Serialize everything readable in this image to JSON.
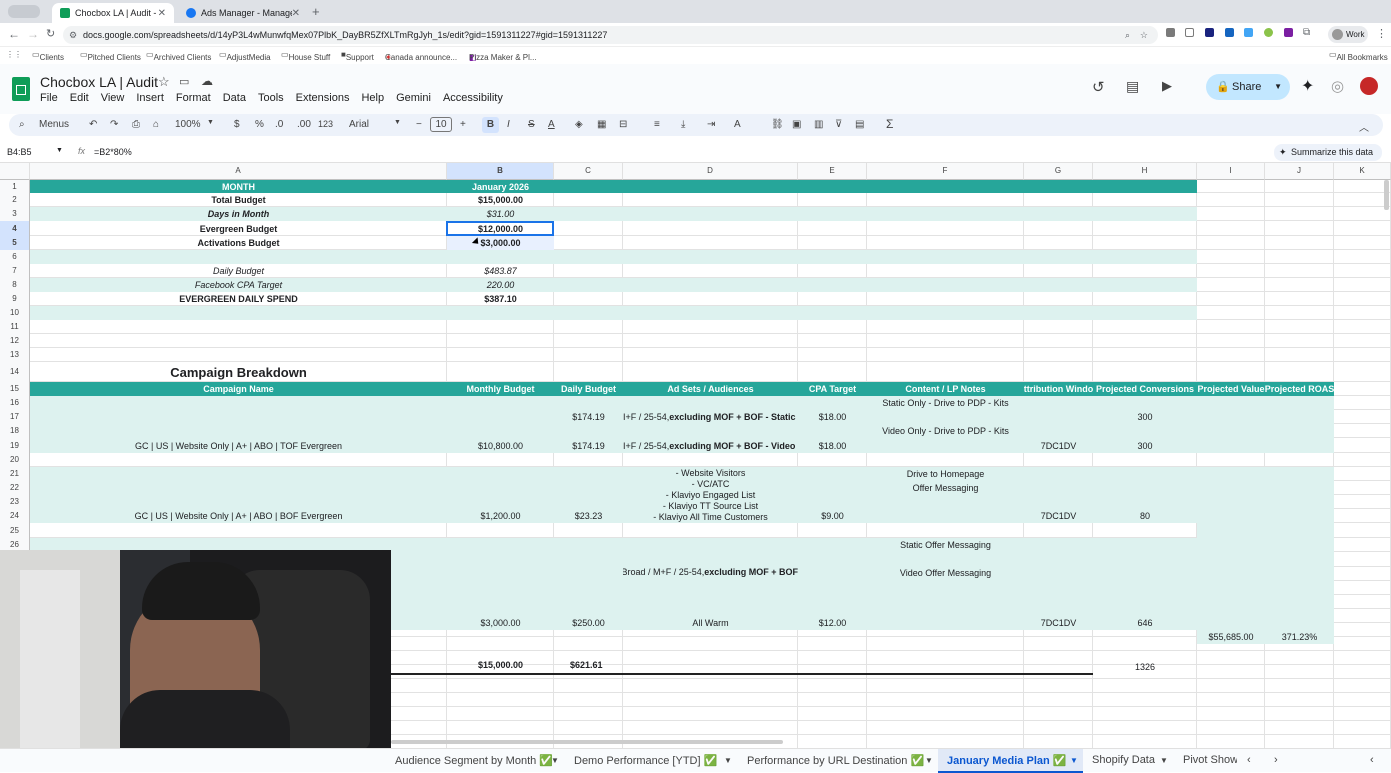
{
  "browser": {
    "tabs": [
      {
        "title": "Chocbox LA | Audit - Google",
        "active": true,
        "favicon_color": "#0f9d58"
      },
      {
        "title": "Ads Manager - Manage ads -",
        "active": false,
        "favicon_color": "#1877f2"
      }
    ],
    "url": "docs.google.com/spreadsheets/d/14yP3L4wMunwfqMex07PlbK_DayBR5ZfXLTmRgJyh_1s/edit?gid=1591311227#gid=1591311227",
    "profile": "Work",
    "bookmarks": [
      "Clients",
      "Pitched Clients",
      "Archived Clients",
      "AdjustMedia",
      "House Stuff",
      "Support",
      "Canada announce...",
      "Pizza Maker & Pl..."
    ],
    "all_bookmarks": "All Bookmarks"
  },
  "doc": {
    "title": "Chocbox LA | Audit",
    "menus": [
      "File",
      "Edit",
      "View",
      "Insert",
      "Format",
      "Data",
      "Tools",
      "Extensions",
      "Help",
      "Gemini",
      "Accessibility"
    ],
    "share_label": "Share"
  },
  "toolbar": {
    "menus_label": "Menus",
    "zoom": "100%",
    "currency": "$",
    "percent": "%",
    "dec_less": ".0",
    "dec_more": ".00",
    "number_format": "123",
    "font": "Arial",
    "font_size": "10",
    "bold": "B",
    "italic": "I",
    "strike": "S",
    "text_color": "A",
    "sum": "Σ",
    "minus": "−",
    "plus": "+"
  },
  "formula_bar": {
    "name_box": "B4:B5",
    "fx": "fx",
    "formula": "=B2*80%",
    "summarize": "Summarize this data"
  },
  "columns": [
    "A",
    "B",
    "C",
    "D",
    "E",
    "F",
    "G",
    "H",
    "I",
    "J",
    "K"
  ],
  "rows": [
    "1",
    "2",
    "3",
    "4",
    "5",
    "6",
    "7",
    "8",
    "9",
    "10",
    "11",
    "12",
    "13",
    "14",
    "15",
    "16",
    "17",
    "18",
    "19",
    "20",
    "21",
    "22",
    "23",
    "24",
    "25",
    "26"
  ],
  "summary": {
    "month_label": "MONTH",
    "month_value": "January 2026",
    "total_budget_label": "Total Budget",
    "total_budget": "$15,000.00",
    "days_label": "Days in Month",
    "days": "$31.00",
    "evergreen_label": "Evergreen Budget",
    "evergreen": "$12,000.00",
    "activations_label": "Activations Budget",
    "activations": "$3,000.00",
    "daily_label": "Daily Budget",
    "daily": "$483.87",
    "cpa_label": "Facebook CPA Target",
    "cpa": "220.00",
    "evergreen_daily_label": "EVERGREEN DAILY SPEND",
    "evergreen_daily": "$387.10"
  },
  "breakdown": {
    "title": "Campaign Breakdown",
    "headers": [
      "Campaign Name",
      "Monthly Budget",
      "Daily Budget",
      "Ad Sets / Audiences",
      "CPA Target",
      "Content / LP Notes",
      "ttribution Windo",
      "Projected Conversions",
      "Projected Value",
      "Projected ROAS"
    ],
    "tof": {
      "name": "GC | US | Website Only | A+ | ABO  | TOF Evergreen",
      "monthly": "$10,800.00",
      "daily1": "$174.19",
      "daily2": "$174.19",
      "adset1_prefix": "I+F / 25-54, ",
      "adset1_bold": "excluding MOF + BOF - Static",
      "adset2_prefix": "I+F / 25-54, ",
      "adset2_bold": "excluding MOF + BOF - Video",
      "cpa1": "$18.00",
      "cpa2": "$18.00",
      "note1": "Static Only - Drive to PDP - Kits",
      "note2": "Video Only - Drive to PDP - Kits",
      "attribution": "7DC1DV",
      "conv1": "300",
      "conv2": "300"
    },
    "bof": {
      "name": "GC | US | Website Only | A+ | ABO  | BOF Evergreen",
      "monthly": "$1,200.00",
      "daily": "$23.23",
      "audiences": [
        "- Website Visitors",
        "- VC/ATC",
        "- Klaviyo Engaged List",
        "- Klaviyo TT Source List",
        "- Klaviyo All Time Customers"
      ],
      "cpa": "$9.00",
      "note1": "Drive to Homepage",
      "note2": "Offer Messaging",
      "attribution": "7DC1DV",
      "conv": "80"
    },
    "act": {
      "monthly": "$3,000.00",
      "daily": "$250.00",
      "adset_prefix": "Broad / M+F / 25-54, ",
      "adset_bold": "excluding MOF + BOF",
      "audience": "All Warm",
      "cpa": "$12.00",
      "note1": "Static Offer Messaging",
      "note2": "Video Offer Messaging",
      "attribution": "7DC1DV",
      "conv": "646"
    },
    "projected_value": "$55,685.00",
    "projected_roas": "371.23%",
    "total_monthly": "$15,000.00",
    "total_daily": "$621.61",
    "total_conv": "1326"
  },
  "sheet_tabs": [
    "Audience Segment by Month ✅",
    "Demo Performance [YTD] ✅",
    "Performance by URL Destination ✅",
    "January Media Plan ✅",
    "Shopify Data",
    "Pivot Show"
  ],
  "colors": {
    "teal": "#26a69a",
    "light_teal": "#ddf2ef",
    "selection": "#1a73e8",
    "sheets_green": "#0f9d58"
  }
}
